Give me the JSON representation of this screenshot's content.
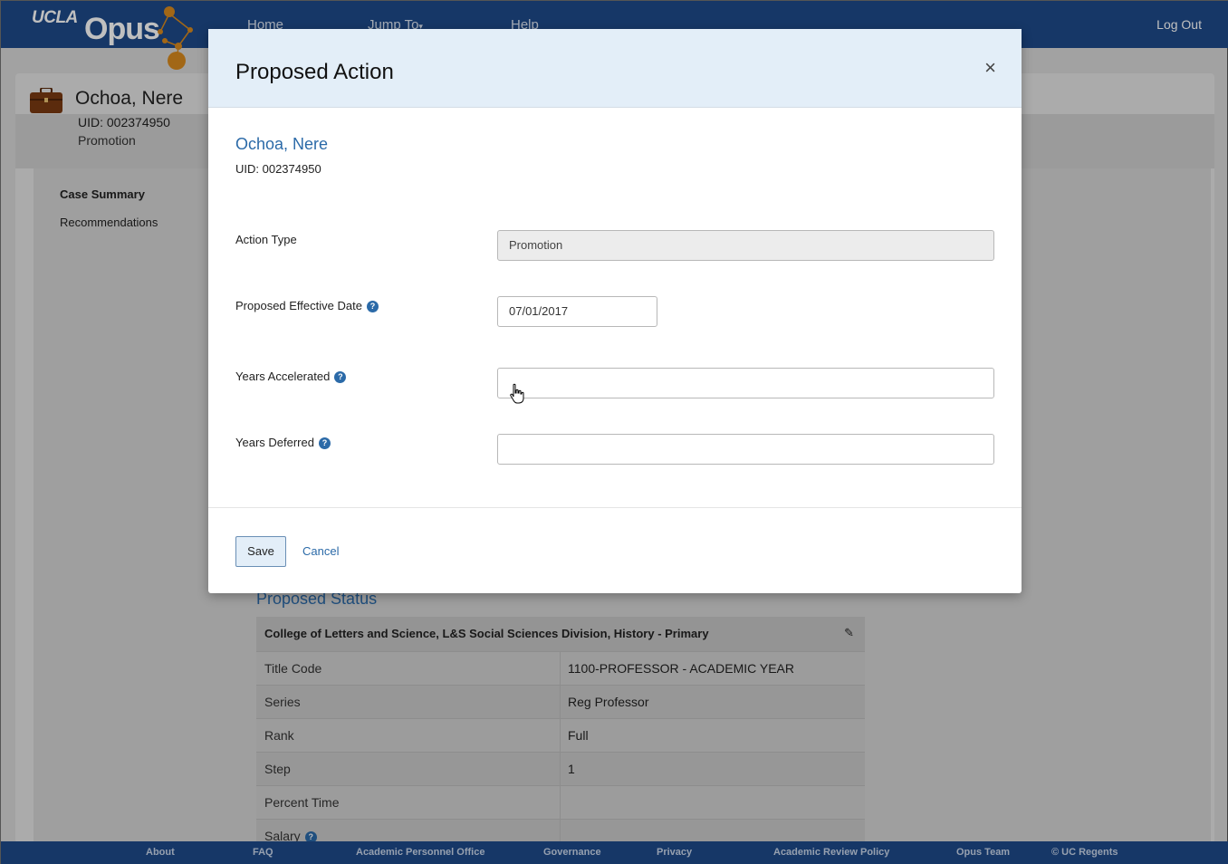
{
  "topbar": {
    "brand_ucla": "UCLA",
    "brand_opus": "Opus",
    "nav": [
      "Home",
      "Jump To",
      "Help"
    ],
    "logout": "Log Out"
  },
  "case": {
    "name": "Ochoa, Nere",
    "uid_label": "UID:",
    "uid": "002374950",
    "action": "Promotion"
  },
  "sidebar": {
    "items": [
      {
        "label": "Case Summary",
        "bold": true
      },
      {
        "label": "Recommendations",
        "bold": false
      }
    ]
  },
  "proposed_status": {
    "title": "Proposed Status",
    "header": "College of Letters and Science, L&S Social Sciences Division, History - Primary",
    "rows": [
      {
        "key": "Title Code",
        "value": "1100-PROFESSOR - ACADEMIC YEAR"
      },
      {
        "key": "Series",
        "value": "Reg Professor"
      },
      {
        "key": "Rank",
        "value": "Full"
      },
      {
        "key": "Step",
        "value": "1"
      },
      {
        "key": "Percent Time",
        "value": ""
      },
      {
        "key": "Salary",
        "value": ""
      }
    ]
  },
  "modal": {
    "title": "Proposed Action",
    "close": "×",
    "employee_name": "Ochoa, Nere",
    "employee_uid": "UID: 002374950",
    "fields": {
      "action_type": {
        "label": "Action Type",
        "value": "Promotion"
      },
      "effective_date": {
        "label": "Proposed Effective Date",
        "value": "07/01/2017"
      },
      "years_accelerated": {
        "label": "Years Accelerated",
        "value": ""
      },
      "years_deferred": {
        "label": "Years Deferred",
        "value": ""
      }
    },
    "save": "Save",
    "cancel": "Cancel"
  },
  "footer": {
    "links": [
      "About",
      "FAQ",
      "Academic Personnel Office",
      "Governance",
      "Privacy",
      "Academic Review Policy",
      "Opus Team",
      "© UC Regents"
    ]
  },
  "colors": {
    "brand_blue": "#1e4a8a",
    "accent_orange": "#d98a1e",
    "link_blue": "#2b6aa8",
    "modal_header": "#e3eef8"
  }
}
